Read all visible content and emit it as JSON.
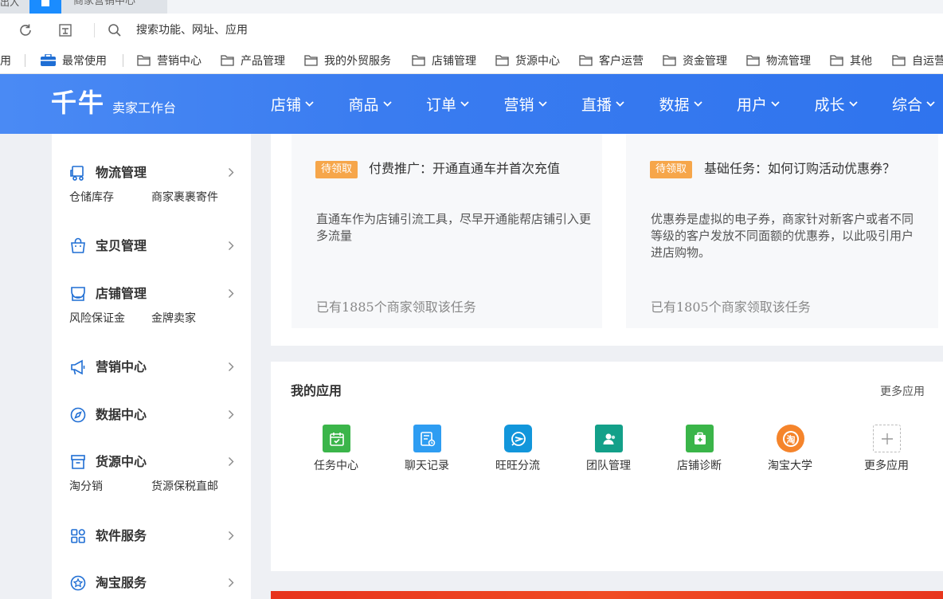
{
  "browser": {
    "prev_tab_fragment": "出入",
    "active_tab_title": "商家营销中心",
    "address_placeholder": "搜索功能、网址、应用",
    "bookmarks_lead_fragment": "用",
    "bookmarks": [
      {
        "label": "最常使用",
        "icon": "toolbox-icon"
      },
      {
        "label": "营销中心",
        "icon": "folder-icon"
      },
      {
        "label": "产品管理",
        "icon": "folder-icon"
      },
      {
        "label": "我的外贸服务",
        "icon": "folder-icon"
      },
      {
        "label": "店铺管理",
        "icon": "folder-icon"
      },
      {
        "label": "货源中心",
        "icon": "folder-icon"
      },
      {
        "label": "客户运营",
        "icon": "folder-icon"
      },
      {
        "label": "资金管理",
        "icon": "folder-icon"
      },
      {
        "label": "物流管理",
        "icon": "folder-icon"
      },
      {
        "label": "其他",
        "icon": "folder-icon"
      },
      {
        "label": "自运营",
        "icon": "folder-icon"
      }
    ]
  },
  "header": {
    "logo": "千牛",
    "subtitle": "卖家工作台",
    "nav": [
      "店铺",
      "商品",
      "订单",
      "营销",
      "直播",
      "数据",
      "用户",
      "成长",
      "综合"
    ]
  },
  "sidebar": {
    "groups": [
      {
        "label": "物流管理",
        "icon": "truck-icon",
        "links": [
          "仓储库存",
          "商家裹裹寄件"
        ]
      },
      {
        "label": "宝贝管理",
        "icon": "shopping-bag-icon",
        "links": []
      },
      {
        "label": "店铺管理",
        "icon": "store-icon",
        "links": [
          "风险保证金",
          "金牌卖家"
        ]
      },
      {
        "label": "营销中心",
        "icon": "megaphone-icon",
        "links": []
      },
      {
        "label": "数据中心",
        "icon": "compass-icon",
        "links": []
      },
      {
        "label": "货源中心",
        "icon": "box-icon",
        "links": [
          "淘分销",
          "货源保税直邮"
        ]
      },
      {
        "label": "软件服务",
        "icon": "apps-grid-icon",
        "links": []
      },
      {
        "label": "淘宝服务",
        "icon": "star-badge-icon",
        "links": []
      }
    ]
  },
  "tasks": [
    {
      "badge": "待领取",
      "title": "付费推广：开通直通车并首次充值",
      "description": "直通车作为店铺引流工具，尽早开通能帮店铺引入更多流量",
      "count": "已有1885个商家领取该任务"
    },
    {
      "badge": "待领取",
      "title": "基础任务：如何订购活动优惠券？",
      "description": "优惠券是虚拟的电子券，商家针对新客户或者不同等级的客户发放不同面额的优惠券，以此吸引用户进店购物。",
      "count": "已有1805个商家领取该任务"
    }
  ],
  "my_apps": {
    "title": "我的应用",
    "more_link": "更多应用",
    "apps": [
      {
        "label": "任务中心",
        "color": "#3bb54a",
        "icon": "calendar-check-icon"
      },
      {
        "label": "聊天记录",
        "color": "#2e9df2",
        "icon": "chat-record-icon"
      },
      {
        "label": "旺旺分流",
        "color": "#1296db",
        "icon": "wangwang-icon"
      },
      {
        "label": "团队管理",
        "color": "#13a089",
        "icon": "team-icon"
      },
      {
        "label": "店铺诊断",
        "color": "#3ab549",
        "icon": "medical-kit-icon"
      },
      {
        "label": "淘宝大学",
        "color": "#f5842b",
        "icon": "taobao-university-icon"
      },
      {
        "label": "更多应用",
        "color": "#ffffff",
        "icon": "plus-icon"
      }
    ]
  }
}
